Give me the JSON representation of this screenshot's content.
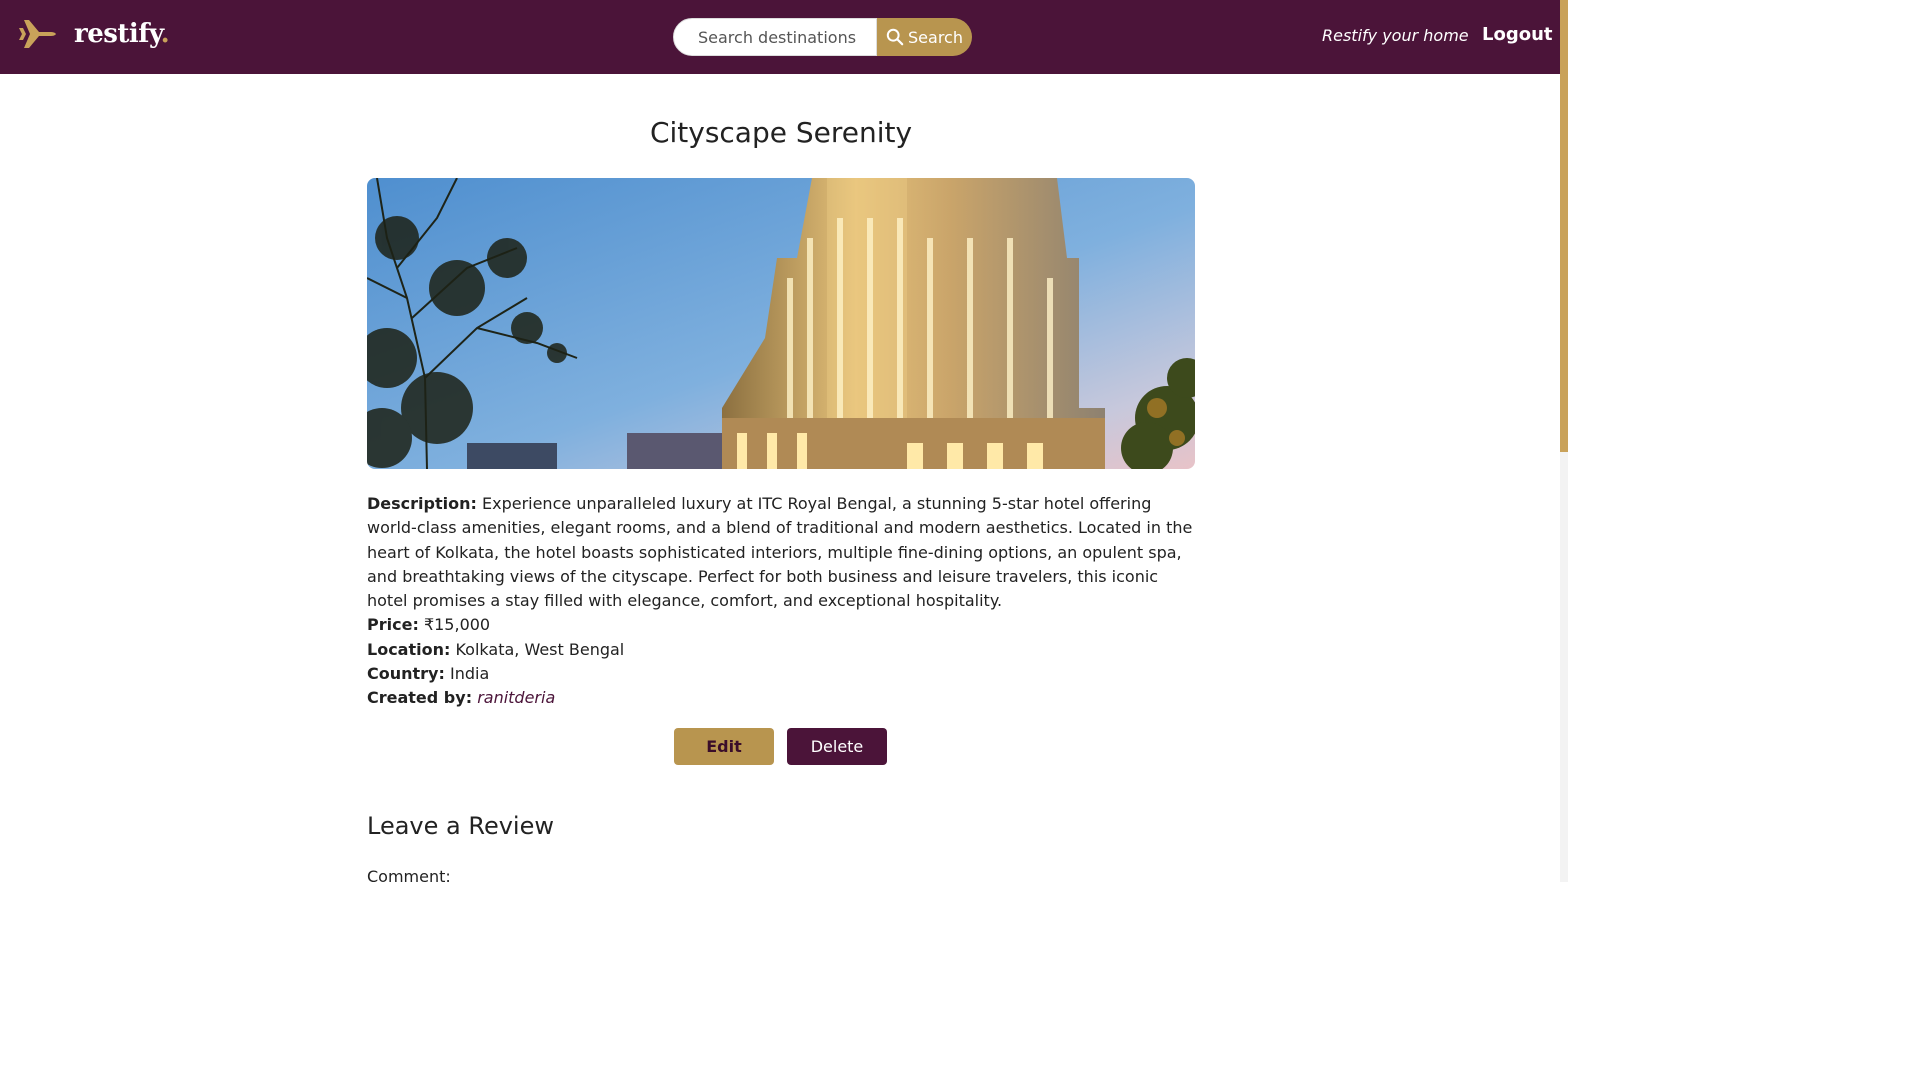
{
  "navbar": {
    "brand_name": "restify",
    "brand_dot": ".",
    "search_placeholder": "Search destinations",
    "search_button_label": "Search",
    "home_link": "Restify your home",
    "logout_link": "Logout"
  },
  "listing": {
    "title": "Cityscape Serenity",
    "description_label": "Description:",
    "description": "Experience unparalleled luxury at ITC Royal Bengal, a stunning 5-star hotel offering world-class amenities, elegant rooms, and a blend of traditional and modern aesthetics. Located in the heart of Kolkata, the hotel boasts sophisticated interiors, multiple fine-dining options, an opulent spa, and breathtaking views of the cityscape. Perfect for both business and leisure travelers, this iconic hotel promises a stay filled with elegance, comfort, and exceptional hospitality.",
    "price_label": "Price:",
    "price": "₹15,000",
    "location_label": "Location:",
    "location": "Kolkata, West Bengal",
    "country_label": "Country:",
    "country": "India",
    "created_by_label": "Created by:",
    "created_by": "ranitderia"
  },
  "actions": {
    "edit_label": "Edit",
    "delete_label": "Delete"
  },
  "review": {
    "heading": "Leave a Review",
    "comment_label": "Comment:"
  },
  "colors": {
    "navbar_bg": "#4b1439",
    "accent_gold": "#b8954f"
  }
}
